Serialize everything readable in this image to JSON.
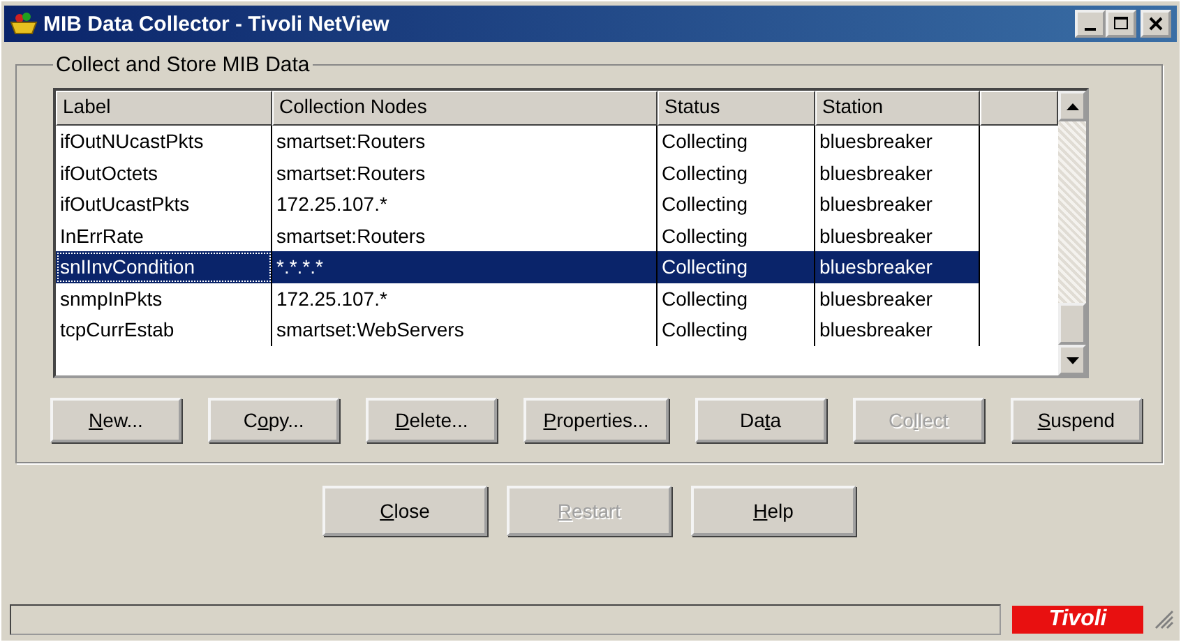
{
  "window": {
    "title": "MIB Data Collector - Tivoli NetView"
  },
  "group": {
    "title": "Collect and Store MIB Data"
  },
  "table": {
    "columns": [
      "Label",
      "Collection Nodes",
      "Status",
      "Station"
    ],
    "rows": [
      {
        "cells": [
          "ifOutNUcastPkts",
          "smartset:Routers",
          "Collecting",
          "bluesbreaker"
        ],
        "selected": false
      },
      {
        "cells": [
          "ifOutOctets",
          "smartset:Routers",
          "Collecting",
          "bluesbreaker"
        ],
        "selected": false
      },
      {
        "cells": [
          "ifOutUcastPkts",
          "172.25.107.*",
          "Collecting",
          "bluesbreaker"
        ],
        "selected": false
      },
      {
        "cells": [
          "InErrRate",
          "smartset:Routers",
          "Collecting",
          "bluesbreaker"
        ],
        "selected": false
      },
      {
        "cells": [
          "snIInvCondition",
          "*.*.*.*",
          "Collecting",
          "bluesbreaker"
        ],
        "selected": true
      },
      {
        "cells": [
          "snmpInPkts",
          "172.25.107.*",
          "Collecting",
          "bluesbreaker"
        ],
        "selected": false
      },
      {
        "cells": [
          "tcpCurrEstab",
          "smartset:WebServers",
          "Collecting",
          "bluesbreaker"
        ],
        "selected": false
      }
    ]
  },
  "action_buttons": [
    {
      "key": "N",
      "after": "ew...",
      "disabled": false
    },
    {
      "before": "C",
      "key": "o",
      "after": "py...",
      "disabled": false
    },
    {
      "key": "D",
      "after": "elete...",
      "disabled": false
    },
    {
      "key": "P",
      "after": "roperties...",
      "disabled": false
    },
    {
      "before": "Da",
      "key": "t",
      "after": "a",
      "disabled": false
    },
    {
      "before": "Co",
      "key": "l",
      "after": "lect",
      "disabled": true
    },
    {
      "key": "S",
      "after": "uspend",
      "disabled": false
    }
  ],
  "dialog_buttons": [
    {
      "key": "C",
      "after": "lose",
      "disabled": false
    },
    {
      "key": "R",
      "after": "estart",
      "disabled": true
    },
    {
      "key": "H",
      "after": "elp",
      "disabled": false
    }
  ],
  "status_bar": {
    "logo": "Tivoli"
  }
}
